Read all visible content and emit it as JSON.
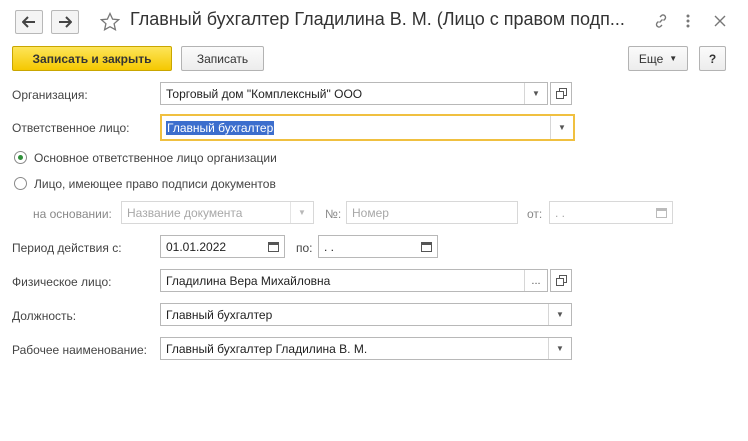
{
  "window": {
    "title": "Главный бухгалтер Гладилина В. М. (Лицо с правом подп...",
    "nav": {
      "back_icon": "arrow-left-icon",
      "forward_icon": "arrow-right-icon",
      "favorite_icon": "star-icon"
    },
    "header_icons": {
      "link": "link-icon",
      "menu": "more-vertical-icon",
      "close": "close-icon"
    }
  },
  "toolbar": {
    "save_close_label": "Записать и закрыть",
    "save_label": "Записать",
    "more_label": "Еще",
    "help_label": "?"
  },
  "form": {
    "organization": {
      "label": "Организация:",
      "value": "Торговый дом \"Комплексный\" ООО"
    },
    "responsible": {
      "label": "Ответственное лицо:",
      "value": "Главный бухгалтер"
    },
    "radio_main": {
      "label": "Основное ответственное лицо организации",
      "selected": true
    },
    "radio_sign": {
      "label": "Лицо, имеющее право подписи документов",
      "selected": false
    },
    "basis": {
      "label": "на основании:",
      "doc_placeholder": "Название документа",
      "number_label": "№:",
      "number_placeholder": "Номер",
      "date_label": "от:",
      "date_placeholder": " .  .    "
    },
    "period": {
      "label": "Период действия с:",
      "from": "01.01.2022",
      "to_label": "по:",
      "to": " .  .    "
    },
    "person": {
      "label": "Физическое лицо:",
      "value": "Гладилина Вера Михайловна",
      "select_label": "..."
    },
    "position": {
      "label": "Должность:",
      "value": "Главный бухгалтер"
    },
    "work_name": {
      "label": "Рабочее наименование:",
      "value": "Главный бухгалтер Гладилина В. М."
    }
  },
  "colors": {
    "primary_button": "#f5c800",
    "focus_border": "#f0c040",
    "selection": "#3c6ecd",
    "radio_dot": "#2f8f3a"
  }
}
